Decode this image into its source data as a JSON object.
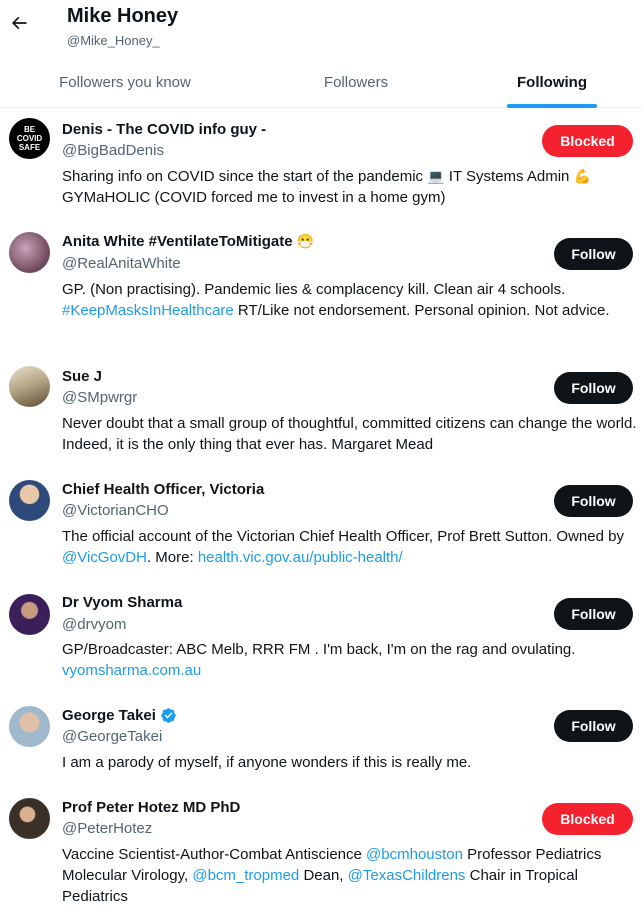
{
  "header": {
    "title": "Mike Honey",
    "handle": "@Mike_Honey_"
  },
  "tabs": [
    {
      "label": "Followers you know"
    },
    {
      "label": "Followers"
    },
    {
      "label": "Following"
    }
  ],
  "users": [
    {
      "name": "Denis - The COVID info guy -",
      "handle": "@BigBadDenis",
      "button": "Blocked",
      "avatar_text": [
        "BE",
        "COVID",
        "SAFE"
      ],
      "bio": [
        {
          "text": "Sharing info on COVID since the start of the pandemic "
        },
        {
          "text": "💻",
          "emoji": true
        },
        {
          "text": " IT Systems Admin "
        },
        {
          "text": "💪",
          "emoji": true
        },
        {
          "text": " GYMaHOLIC (COVID forced me to invest in a home gym)"
        }
      ]
    },
    {
      "name": "Anita White #VentilateToMitigate",
      "name_emoji": "😷",
      "handle": "@RealAnitaWhite",
      "button": "Follow",
      "bio": [
        {
          "text": "GP. (Non practising). Pandemic lies & complacency kill. Clean air 4 schools. "
        },
        {
          "text": "#KeepMasksInHealthcare",
          "link": true
        },
        {
          "text": " RT/Like not endorsement. Personal opinion. Not advice."
        }
      ]
    },
    {
      "name": "Sue J",
      "handle": "@SMpwrgr",
      "button": "Follow",
      "bio": [
        {
          "text": "Never doubt that a small group of thoughtful, committed citizens can change the world. Indeed, it is the only thing that ever has. Margaret Mead"
        }
      ]
    },
    {
      "name": "Chief Health Officer, Victoria",
      "handle": "@VictorianCHO",
      "button": "Follow",
      "bio": [
        {
          "text": "The official account of the Victorian Chief Health Officer, Prof Brett Sutton. Owned by "
        },
        {
          "text": "@VicGovDH",
          "link": true
        },
        {
          "text": ". More: "
        },
        {
          "text": "health.vic.gov.au/public-health/",
          "link": true
        }
      ]
    },
    {
      "name": "Dr Vyom Sharma",
      "handle": "@drvyom",
      "button": "Follow",
      "bio": [
        {
          "text": "GP/Broadcaster: ABC Melb, RRR FM . I'm back, I'm on the rag and ovulating. "
        },
        {
          "text": "vyomsharma.com.au",
          "link": true
        }
      ]
    },
    {
      "name": "George Takei",
      "verified": true,
      "handle": "@GeorgeTakei",
      "button": "Follow",
      "bio": [
        {
          "text": "I am a parody of myself, if anyone wonders if this is really me."
        }
      ]
    },
    {
      "name": "Prof Peter Hotez MD PhD",
      "handle": "@PeterHotez",
      "button": "Blocked",
      "bio": [
        {
          "text": "Vaccine Scientist-Author-Combat Antiscience "
        },
        {
          "text": "@bcmhouston",
          "link": true
        },
        {
          "text": " Professor Pediatrics Molecular Virology, "
        },
        {
          "text": "@bcm_tropmed",
          "link": true
        },
        {
          "text": " Dean, "
        },
        {
          "text": "@TexasChildrens",
          "link": true
        },
        {
          "text": " Chair in Tropical Pediatrics"
        }
      ]
    }
  ],
  "colors": {
    "accent": "#1d9bf0",
    "blocked": "#f4212e",
    "follow": "#0f1419",
    "secondary_text": "#536471"
  }
}
